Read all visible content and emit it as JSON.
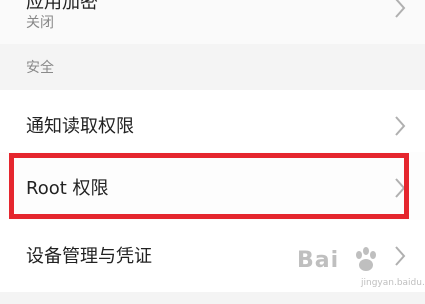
{
  "top_item": {
    "title": "应用加密",
    "subtitle": "关闭"
  },
  "section": {
    "label": "安全"
  },
  "rows": [
    {
      "label": "通知读取权限"
    },
    {
      "label": "Root 权限"
    },
    {
      "label": "设备管理与凭证"
    }
  ],
  "highlight_color": "#e5262e",
  "watermark": {
    "text": "Bai",
    "sub": "jingyan.baidu.com"
  }
}
